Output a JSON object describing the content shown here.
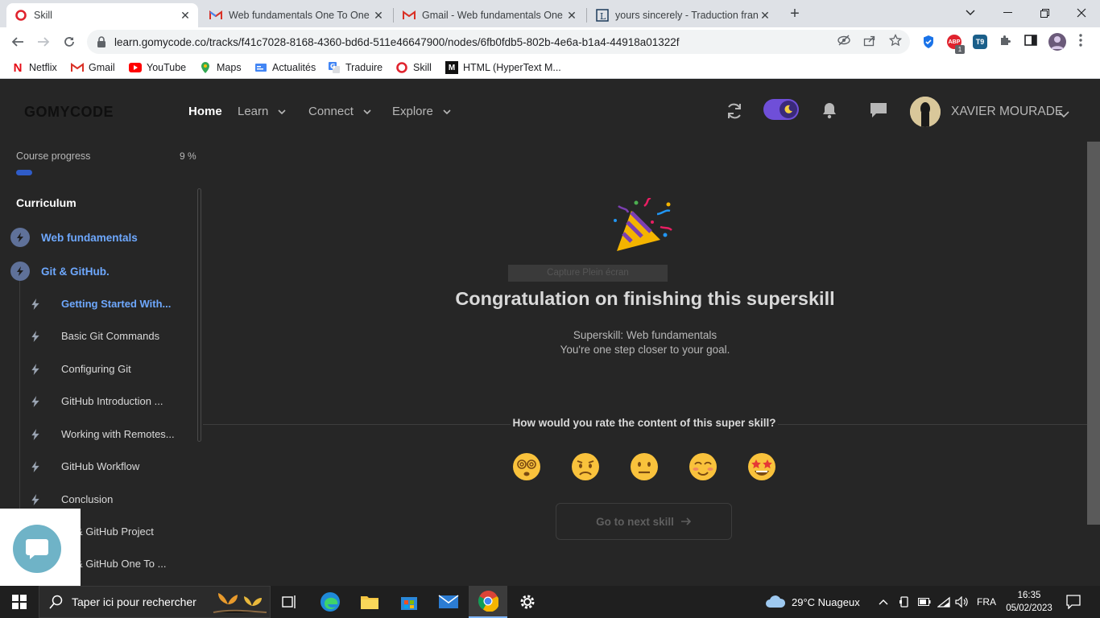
{
  "browser": {
    "tabs": [
      {
        "title": "Skill",
        "active": true
      },
      {
        "title": "Web fundamentals One To One is",
        "active": false
      },
      {
        "title": "Gmail - Web fundamentals One T",
        "active": false
      },
      {
        "title": "yours sincerely - Traduction franç",
        "active": false
      }
    ],
    "url": "learn.gomycode.co/tracks/f41c7028-8168-4360-bd6d-511e46647900/nodes/6fb0fdb5-802b-4e6a-b1a4-44918a01322f",
    "bookmarks": [
      "Netflix",
      "Gmail",
      "YouTube",
      "Maps",
      "Actualités",
      "Traduire",
      "Skill",
      "HTML (HyperText M..."
    ],
    "ext_badge_abp": "1",
    "ext_t9": "T9"
  },
  "site": {
    "logo": "GOMYCODE",
    "nav": {
      "home": "Home",
      "learn": "Learn",
      "connect": "Connect",
      "explore": "Explore"
    },
    "user_name": "XAVIER MOURADE",
    "accent": "#6f4fd8"
  },
  "sidebar": {
    "progress_label": "Course progress",
    "progress_value": "9 %",
    "progress_fraction": 0.09,
    "curriculum_title": "Curriculum",
    "sections": [
      {
        "label": "Web fundamentals"
      },
      {
        "label": "Git & GitHub."
      }
    ],
    "lessons": [
      {
        "label": "Getting Started With...",
        "active": true
      },
      {
        "label": "Basic Git Commands"
      },
      {
        "label": "Configuring Git"
      },
      {
        "label": "GitHub Introduction ..."
      },
      {
        "label": "Working with Remotes..."
      },
      {
        "label": "GitHub Workflow"
      },
      {
        "label": "Conclusion"
      },
      {
        "label": "& GitHub Project"
      },
      {
        "label": "& GitHub One To ..."
      }
    ]
  },
  "main": {
    "overlay_text": "Capture Plein écran",
    "heading": "Congratulation on finishing this superskill",
    "subtitle_line1": "Superskill: Web fundamentals",
    "subtitle_line2": "You're one step closer to your goal.",
    "rating_question": "How would you rate the content of this super skill?",
    "rating_options": [
      "dizzy",
      "worried",
      "neutral",
      "smiling",
      "star-struck"
    ],
    "next_button": "Go to next skill"
  },
  "taskbar": {
    "search_placeholder": "Taper ici pour rechercher",
    "weather": "29°C  Nuageux",
    "language": "FRA",
    "time": "16:35",
    "date": "05/02/2023"
  }
}
